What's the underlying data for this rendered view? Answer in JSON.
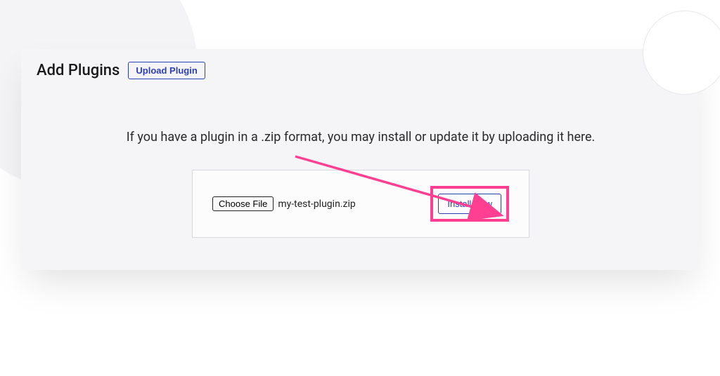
{
  "header": {
    "title": "Add Plugins",
    "upload_button": "Upload Plugin"
  },
  "main": {
    "instruction": "If you have a plugin in a .zip format, you may install or update it by uploading it here.",
    "choose_file_label": "Choose File",
    "filename": "my-test-plugin.zip",
    "install_button": "Install Now"
  },
  "annotation": {
    "arrow_color": "#ff3f92",
    "highlight_color": "#ff3f92"
  }
}
